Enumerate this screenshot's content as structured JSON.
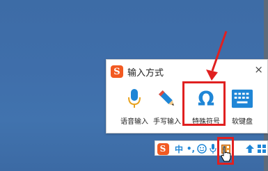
{
  "popup": {
    "title": "输入方式",
    "close_label": "×",
    "tiles": [
      {
        "label": "语音输入",
        "icon": "microphone-icon"
      },
      {
        "label": "手写输入",
        "icon": "pencil-icon"
      },
      {
        "label": "特殊符号",
        "icon": "omega-icon"
      },
      {
        "label": "软键盘",
        "icon": "keyboard-icon"
      }
    ]
  },
  "taskbar": {
    "logo": "S",
    "lang": "中",
    "punct": "•,",
    "items": [
      "emoji-icon",
      "microphone-icon",
      "toolbox-icon",
      "shirt-icon",
      "grid-icon"
    ]
  },
  "colors": {
    "brand": "#f25a22",
    "accent_blue": "#1f86d6",
    "highlight_red": "#e02020"
  }
}
